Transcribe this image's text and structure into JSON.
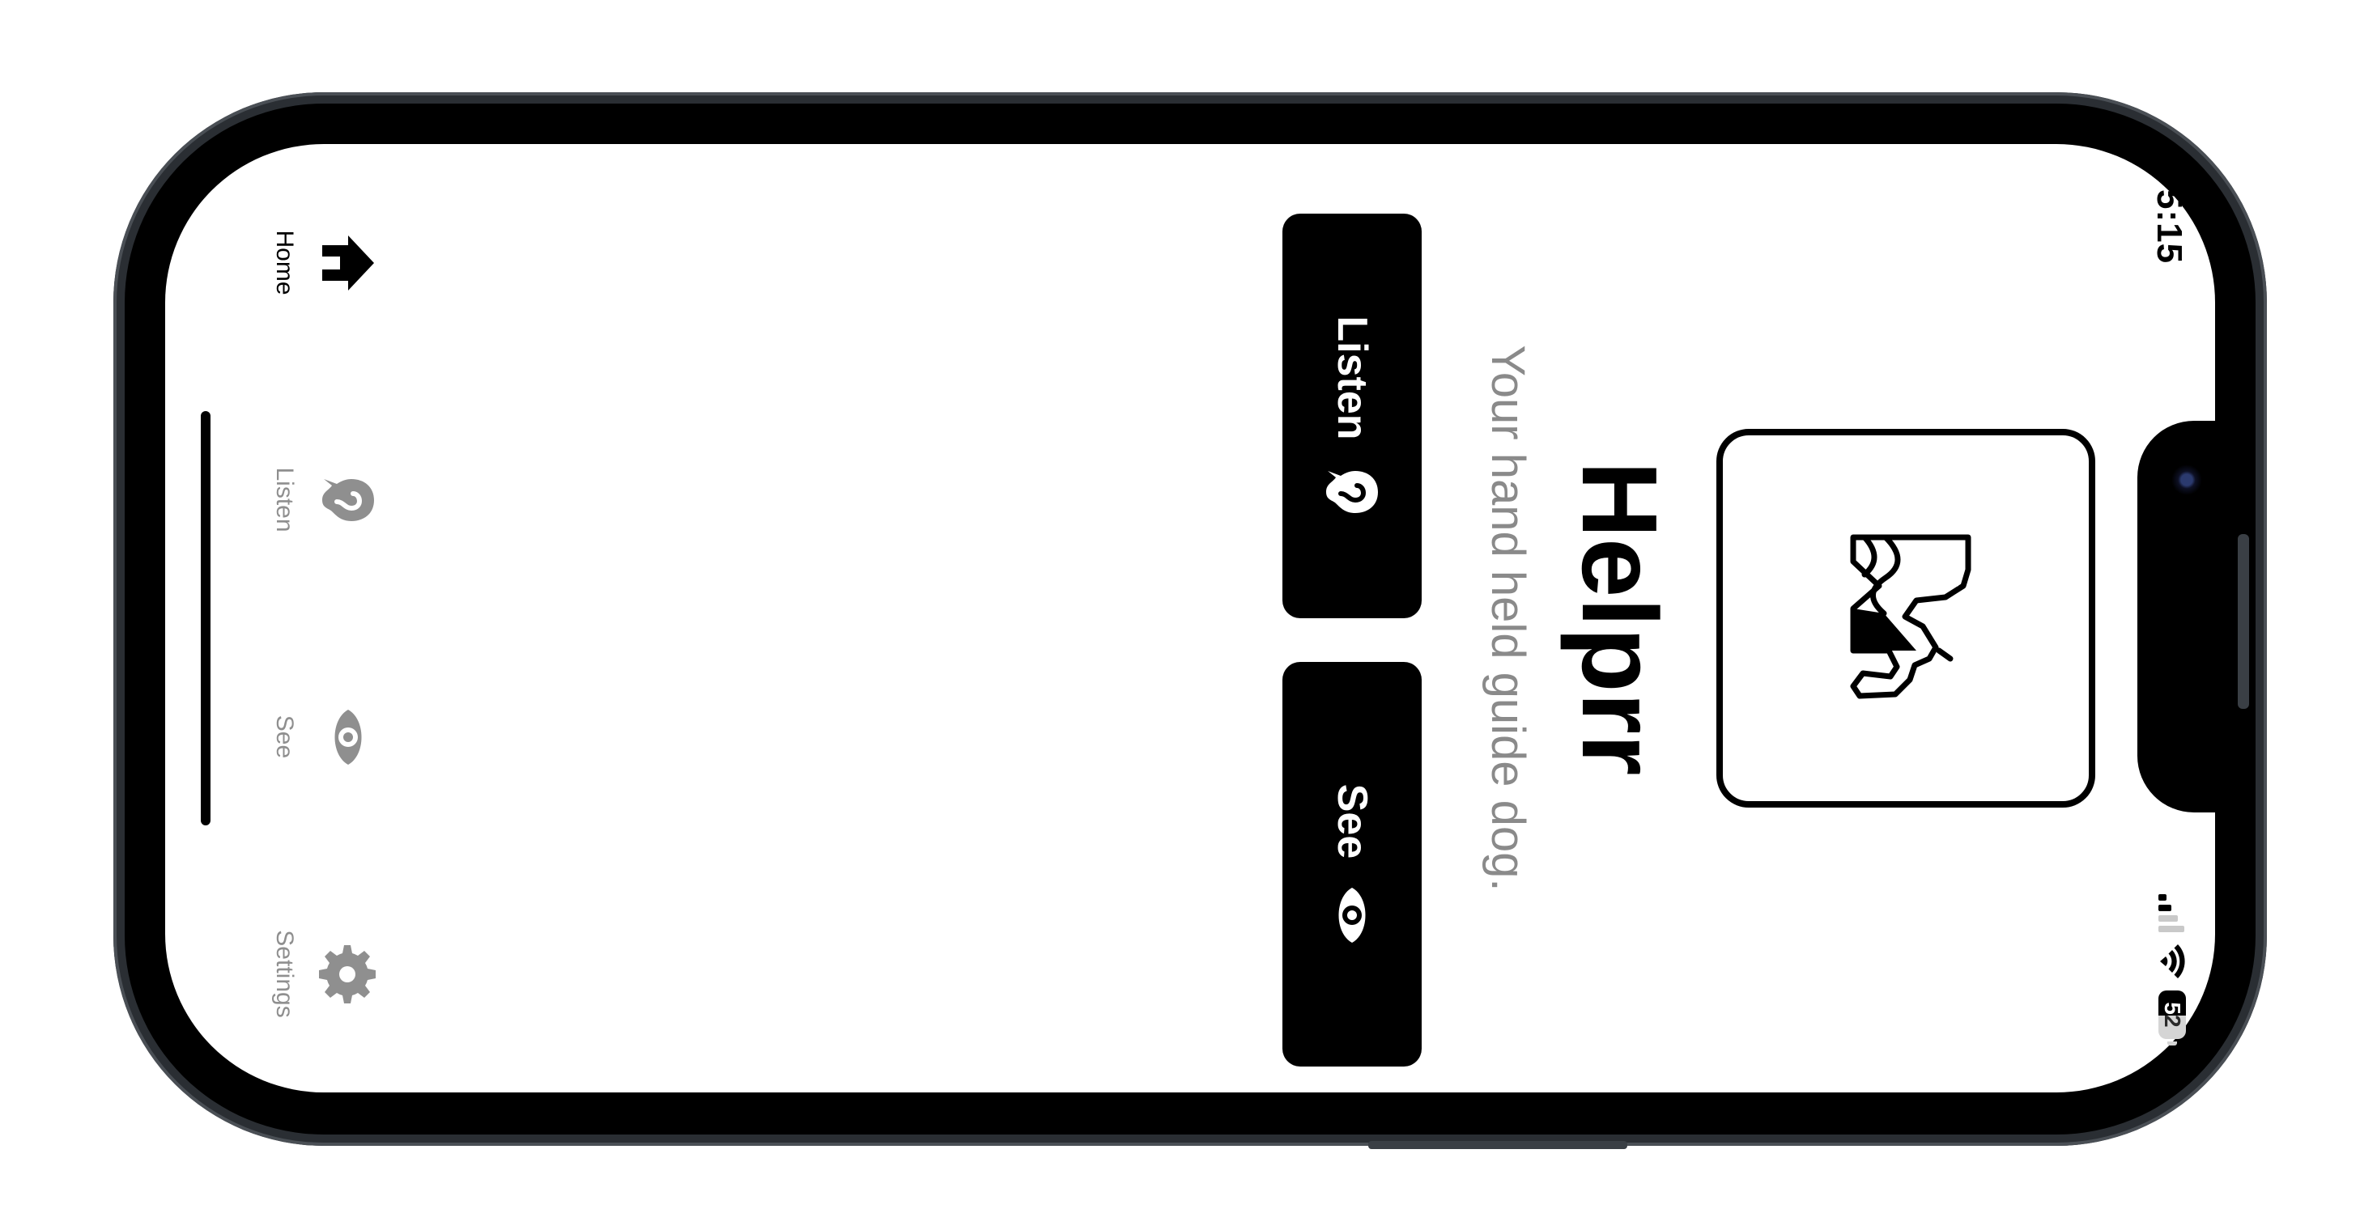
{
  "status_bar": {
    "time": "5:15",
    "battery_level": "52",
    "battery_fraction": 0.52
  },
  "app": {
    "name": "Helprr",
    "tagline": "Your hand held guide dog."
  },
  "actions": {
    "listen_label": "Listen",
    "see_label": "See"
  },
  "tabs": [
    {
      "label": "Home",
      "icon": "home-icon",
      "active": true
    },
    {
      "label": "Listen",
      "icon": "ear-icon",
      "active": false
    },
    {
      "label": "See",
      "icon": "eye-icon",
      "active": false
    },
    {
      "label": "Settings",
      "icon": "gear-icon",
      "active": false
    }
  ],
  "colors": {
    "primary": "#000000",
    "inactive": "#8f8f8f",
    "subtitle": "#8a8a8a",
    "background": "#ffffff"
  }
}
